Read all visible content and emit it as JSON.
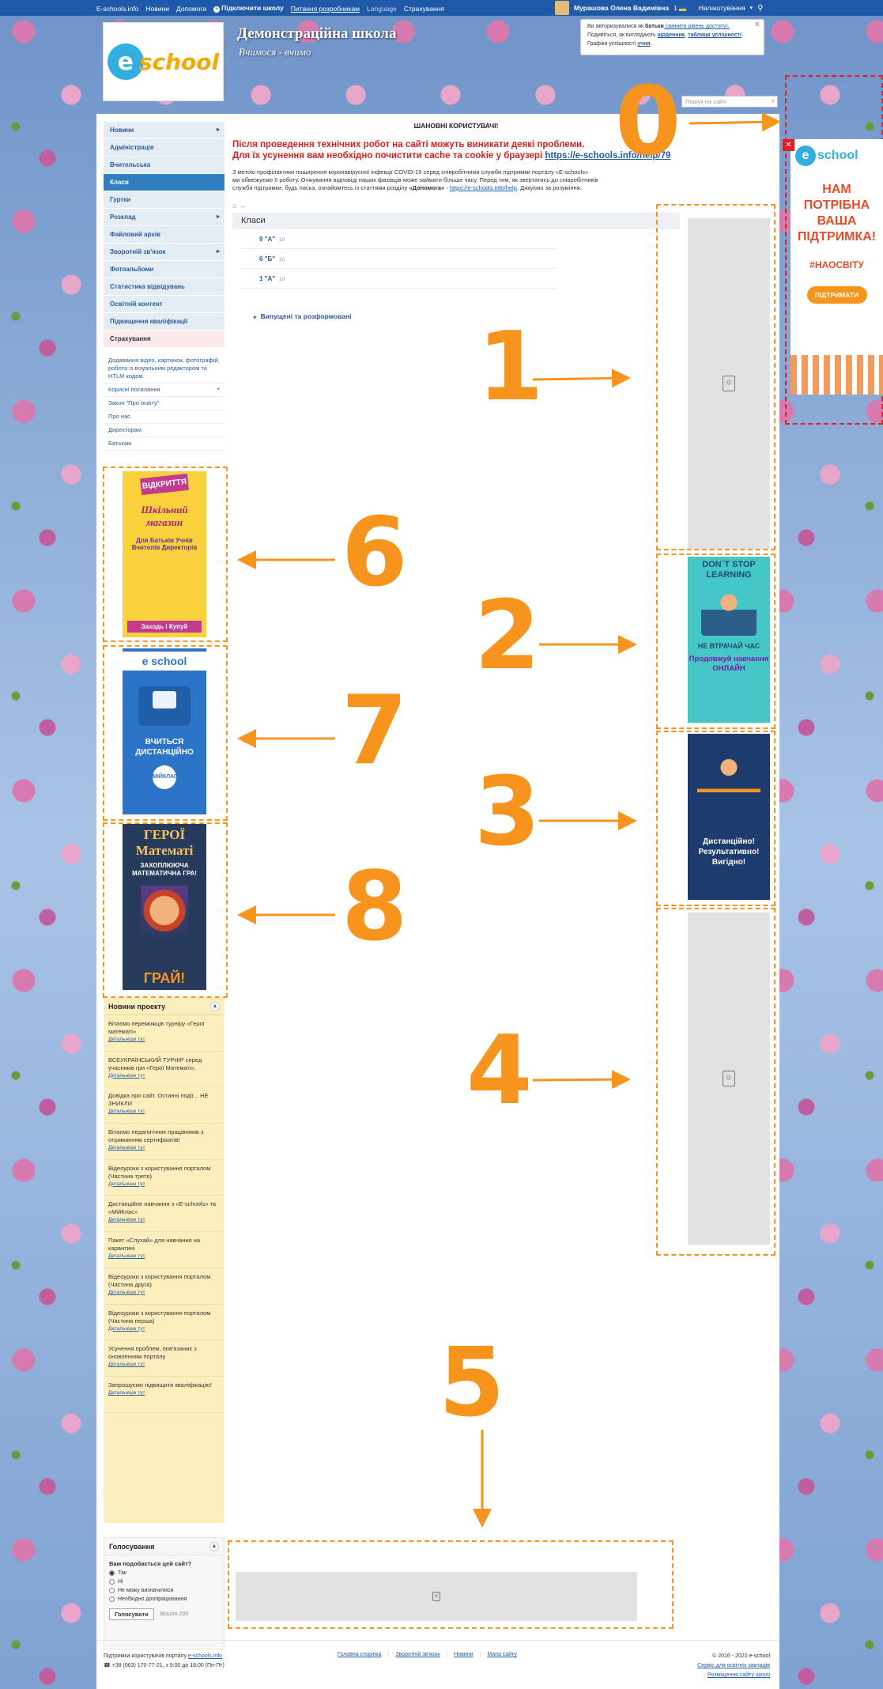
{
  "topbar": {
    "site": "E-schools.info",
    "news": "Новини",
    "help": "Допомога",
    "connect": "Підключити школу",
    "dev": "Питання розробникам",
    "lang": "Language",
    "insurance": "Страхування",
    "user": "Мурашова Олена Вадимівна",
    "count": "1",
    "settings": "Налаштування"
  },
  "header": {
    "school_name": "Демонстраційна школа",
    "motto": "Вчимося - вчимо",
    "logo_e": "e",
    "logo_text": "school",
    "search_placeholder": "Пошук на сайті"
  },
  "notice": {
    "l1a": "Ви авторизувалися як ",
    "l1b": "батьки",
    "l1c": " (змінити рівень доступу).",
    "l2a": "Подивіться, як виглядають ",
    "l2b": "щоденник",
    "l2c": ", ",
    "l2d": "таблиця успішності",
    "l2e": ".",
    "l3a": "Графіки успішності ",
    "l3b": "учня",
    "l3c": "."
  },
  "menu": [
    {
      "label": "Новини",
      "arrow": true
    },
    {
      "label": "Адміністрація",
      "arrow": false
    },
    {
      "label": "Вчительська",
      "arrow": false
    },
    {
      "label": "Класи",
      "arrow": false,
      "active": true
    },
    {
      "label": "Гуртки",
      "arrow": false
    },
    {
      "label": "Розклад",
      "arrow": true
    },
    {
      "label": "Файловий архів",
      "arrow": false
    },
    {
      "label": "Зворотній зв'язок",
      "arrow": true
    },
    {
      "label": "Фотоальбоми",
      "arrow": false
    },
    {
      "label": "Статистика відвідувань",
      "arrow": false
    },
    {
      "label": "Освітній контент",
      "arrow": false
    },
    {
      "label": "Підвищення кваліфікації",
      "arrow": false
    },
    {
      "label": "Страхування",
      "arrow": false,
      "pink": true
    }
  ],
  "links": [
    "Додавання відео, картинок, фотографій, робота із візуальним редактором та HTLM кодом.",
    "Корисні посилання",
    "Закон \"Про освіту\"",
    "Про нас",
    "Директорам",
    "Батькам"
  ],
  "content": {
    "title": "ШАНОВНІ КОРИСТУВАЧІ!",
    "warn1": "Після проведення технічних робот на сайті можуть виникати деякі проблеми.",
    "warn2": "Для їх усунення вам необхідно почистити cache та cookie у браузері",
    "warn_link": "https://e-schools.info/help/79",
    "covid1": "З метою профілактики поширення коронавірусної інфекції COVID-19 серед співробітників служби підтримки порталу «E-schools»",
    "covid2": "ми обмежуємо її роботу. Очікування відповіді наших фахівців може займати більше часу. Перед тим, як звертатись до співробітників",
    "covid3a": "служби підтримки, будь ласка, ознайомтесь із статтями розділу ",
    "covid3b": "«Допомога»",
    "covid3c": " - ",
    "covid3d": "https://e-schools.info/help",
    "covid3e": ". Дякуємо за розуміння.",
    "crumbs": "⌂ →",
    "section": "Класи",
    "classes": [
      {
        "name": "9 \"А\"",
        "count": "10"
      },
      {
        "name": "6 \"Б\"",
        "count": "10"
      },
      {
        "name": "1 \"А\"",
        "count": "10"
      }
    ],
    "graduated": "Випущені та розформовані"
  },
  "banners": {
    "shop": {
      "top": "ВІДКРИТТЯ",
      "mid": "Шкільний магазин",
      "sub": "Для Батьків Учнів Вчителів Директорів",
      "btn": "Заходь і Купуй"
    },
    "es": {
      "logo": "e school",
      "tx": "ВЧИТЬСЯ ДИСТАНЦІЙНО",
      "mark": "МІЙКЛАС"
    },
    "game": {
      "t1": "ГЕРОЇ Математі",
      "t2": "ЗАХОПЛЮЮЧА МАТЕМАТИЧНА ГРА!",
      "play": "ГРАЙ!"
    },
    "dont": {
      "t1": "DON`T STOP LEARNING",
      "t2": "НЕ ВТРАЧАЙ ЧАС",
      "t3": "Продовжуй навчання ОНЛАЙН"
    },
    "dist": {
      "t": "Дистанційно! Результативно! Вигідно!"
    },
    "right": {
      "e": "e",
      "s": "school",
      "h": "НАМ ПОТРІБНА ВАША ПІДТРИМКА!",
      "tag": "#НАОСВІТУ",
      "btn": "ПІДТРИМАТИ"
    }
  },
  "news": {
    "title": "Новини проекту",
    "more": "Детальніше тут",
    "items": [
      "Вітаємо переможців турніру «Герої математі»",
      "ВСЕУКРАЇНСЬКИЙ ТУРНІР серед учасників гри «Герої Математі».",
      "Довідка про сайт. Останні події... НЕ ЗНИКЛИ",
      "Вітаємо педагогічних працівників з отриманням сертифікатів!",
      "Відеоуроки з користування порталом (Частина третя)",
      "Дистанційне навчання з «E-schools» та «МійКлас»",
      "Пакет «Слухай» для навчання на карантині",
      "Відеоуроки з користування порталом (Частина друга)",
      "Відеоуроки з користування порталом (Частина перша)",
      "Усунення проблем, пов'язаних з оновленням порталу",
      "Запрошуємо підвищити кваліфікацію!"
    ]
  },
  "poll": {
    "title": "Голосування",
    "question": "Вам подобається цей сайт?",
    "options": [
      "Так",
      "Ні",
      "Не можу визначитися",
      "Необхідно доопрацювання"
    ],
    "button": "Голосувати",
    "total": "Всього 200"
  },
  "annotations": [
    "0",
    "1",
    "2",
    "3",
    "4",
    "5",
    "6",
    "7",
    "8"
  ],
  "footer": {
    "support": "Підтримка користувачів порталу ",
    "support_link": "e-schools.info",
    "phone": "☎ +38 (063) 170-77-21, з 9:00 до 18:00 (Пн-Пт)",
    "links": [
      "Головна сторінка",
      "Зворотній зв'язок",
      "Новини",
      "Мапа сайту"
    ],
    "copy": "© 2016 - 2020 e-school",
    "service": "Сервіс для освітніх закладів",
    "place": "Розміщення сайту школі"
  },
  "colors": {
    "accent": "#f7941d",
    "topbar": "#1e5aa8",
    "link": "#2a5b9a",
    "warning": "#d62020"
  }
}
